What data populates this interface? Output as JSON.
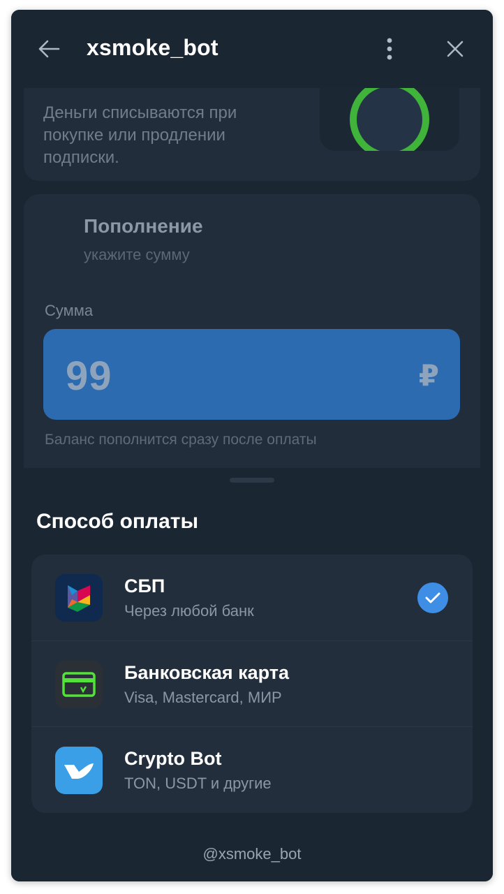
{
  "header": {
    "title": "xsmoke_bot",
    "back_icon": "arrow-left-icon",
    "menu_icon": "more-vertical-icon",
    "close_icon": "close-icon"
  },
  "info_card": {
    "text": "Деньги списываются при покупке или продлении подписки."
  },
  "topup": {
    "title": "Пополнение",
    "subtitle": "укажите сумму",
    "amount_label": "Сумма",
    "amount_value": "99",
    "currency_symbol": "₽",
    "hint": "Баланс пополнится сразу после оплаты"
  },
  "payment": {
    "title": "Способ оплаты",
    "methods": [
      {
        "name": "СБП",
        "description": "Через любой банк",
        "icon": "sbp-icon",
        "selected": true
      },
      {
        "name": "Банковская карта",
        "description": "Visa, Mastercard, МИР",
        "icon": "bank-card-icon",
        "selected": false
      },
      {
        "name": "Crypto Bot",
        "description": "TON, USDT и другие",
        "icon": "crypto-bot-icon",
        "selected": false
      }
    ]
  },
  "footer": {
    "username": "@xsmoke_bot"
  },
  "colors": {
    "background": "#1b2633",
    "card": "#212d3b",
    "input": "#2c6bb0",
    "accent": "#3e8ee6",
    "ring": "#3fb33a"
  }
}
